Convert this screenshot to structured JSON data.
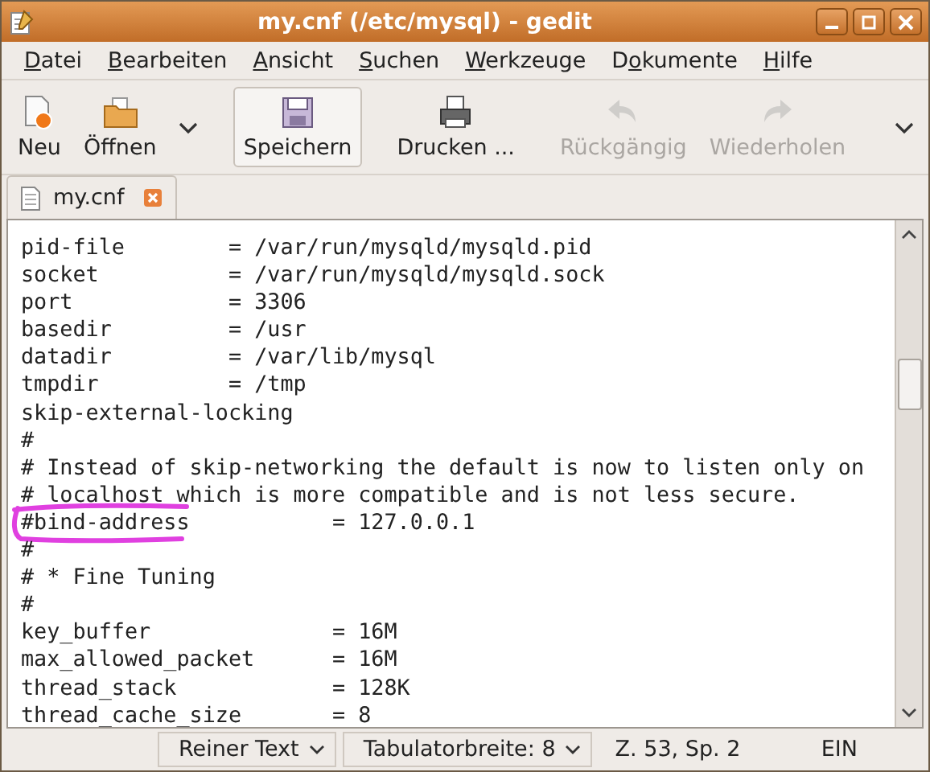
{
  "window": {
    "title": "my.cnf (/etc/mysql) - gedit"
  },
  "menu": [
    {
      "key": "D",
      "after": "atei"
    },
    {
      "key": "B",
      "after": "earbeiten"
    },
    {
      "key": "A",
      "after": "nsicht"
    },
    {
      "key": "S",
      "after": "uchen"
    },
    {
      "key": "W",
      "after": "erkzeuge"
    },
    {
      "before": "D",
      "key": "o",
      "after": "kumente"
    },
    {
      "key": "H",
      "after": "ilfe"
    }
  ],
  "toolbar": [
    {
      "kind": "new",
      "label": "Neu",
      "disabled": false,
      "selected": false
    },
    {
      "kind": "open",
      "label": "Öffnen",
      "disabled": false,
      "selected": false
    },
    {
      "kind": "dropdown"
    },
    {
      "kind": "sep"
    },
    {
      "kind": "save",
      "label": "Speichern",
      "disabled": false,
      "selected": true
    },
    {
      "kind": "sep"
    },
    {
      "kind": "print",
      "label": "Drucken ...",
      "disabled": false,
      "selected": false
    },
    {
      "kind": "sep"
    },
    {
      "kind": "undo",
      "label": "Rückgängig",
      "disabled": true,
      "selected": false
    },
    {
      "kind": "redo",
      "label": "Wiederholen",
      "disabled": true,
      "selected": false
    },
    {
      "kind": "sep"
    },
    {
      "kind": "more"
    }
  ],
  "tabs": [
    {
      "label": "my.cnf",
      "selected": true
    }
  ],
  "editor": {
    "lines": [
      "pid-file        = /var/run/mysqld/mysqld.pid",
      "socket          = /var/run/mysqld/mysqld.sock",
      "port            = 3306",
      "basedir         = /usr",
      "datadir         = /var/lib/mysql",
      "tmpdir          = /tmp",
      "skip-external-locking",
      "#",
      "# Instead of skip-networking the default is now to listen only on",
      "# localhost which is more compatible and is not less secure.",
      "#bind-address           = 127.0.0.1",
      "#",
      "# * Fine Tuning",
      "#",
      "key_buffer              = 16M",
      "max_allowed_packet      = 16M",
      "thread_stack            = 128K",
      "thread_cache_size       = 8"
    ],
    "circled": [
      false,
      false,
      false,
      false,
      false,
      false,
      false,
      false,
      false,
      false,
      true,
      false,
      false,
      false,
      false,
      false,
      false,
      false
    ]
  },
  "status_bar": {
    "language": "Reiner Text",
    "tab_width": "Tabulatorbreite: 8",
    "position": "Z. 53, Sp. 2",
    "mode": "EIN"
  }
}
